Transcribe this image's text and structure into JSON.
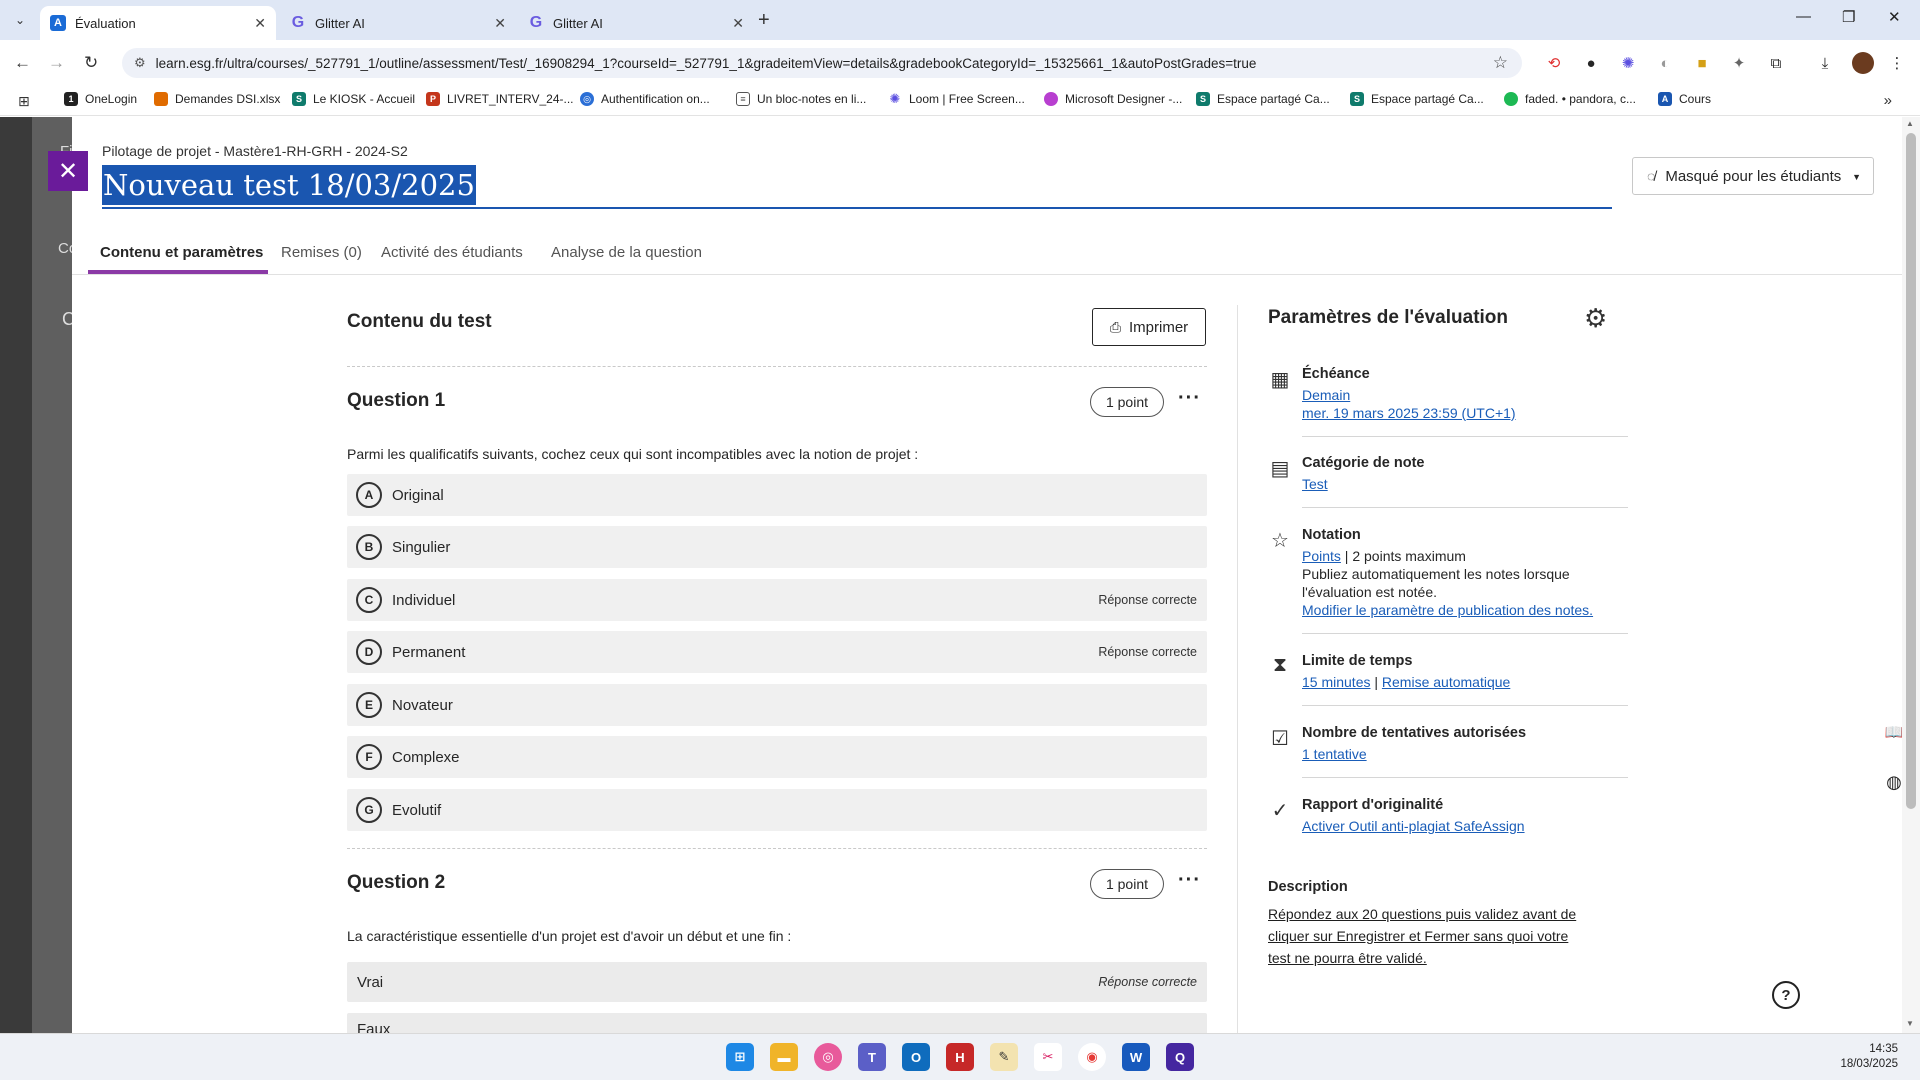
{
  "browser": {
    "tabs": [
      {
        "title": "Évaluation",
        "favicon": "A",
        "active": true
      },
      {
        "title": "Glitter AI",
        "favicon": "G",
        "active": false
      },
      {
        "title": "Glitter AI",
        "favicon": "G",
        "active": false
      }
    ],
    "url": "learn.esg.fr/ultra/courses/_527791_1/outline/assessment/Test/_16908294_1?courseId=_527791_1&gradeitemView=details&gradebookCategoryId=_15325661_1&autoPostGrades=true",
    "bookmarks": [
      "OneLogin",
      "Demandes DSI.xlsx",
      "Le KIOSK - Accueil",
      "LIVRET_INTERV_24-...",
      "Authentification on...",
      "Un bloc-notes en li...",
      "Loom | Free Screen...",
      "Microsoft Designer -...",
      "Espace partagé Ca...",
      "Espace partagé Ca...",
      "faded. • pandora, c...",
      "Cours"
    ]
  },
  "underlay": {
    "stub_top": "Fi",
    "stub_tab": "Co",
    "stub_c": "C"
  },
  "panel": {
    "breadcrumb": "Pilotage de projet - Mastère1-RH-GRH - 2024-S2",
    "title": "Nouveau test 18/03/2025",
    "visibility": "Masqué pour les étudiants",
    "tabs": [
      "Contenu et paramètres",
      "Remises (0)",
      "Activité des étudiants",
      "Analyse de la question"
    ]
  },
  "content": {
    "heading": "Contenu du test",
    "print_label": "Imprimer",
    "questions": [
      {
        "title": "Question 1",
        "points": "1  point",
        "text": "Parmi les qualificatifs suivants, cochez ceux qui sont incompatibles avec la notion de projet :",
        "answers": [
          {
            "letter": "A",
            "text": "Original",
            "correct": ""
          },
          {
            "letter": "B",
            "text": "Singulier",
            "correct": ""
          },
          {
            "letter": "C",
            "text": "Individuel",
            "correct": "Réponse correcte"
          },
          {
            "letter": "D",
            "text": "Permanent",
            "correct": "Réponse correcte"
          },
          {
            "letter": "E",
            "text": "Novateur",
            "correct": ""
          },
          {
            "letter": "F",
            "text": "Complexe",
            "correct": ""
          },
          {
            "letter": "G",
            "text": "Evolutif",
            "correct": ""
          }
        ]
      },
      {
        "title": "Question 2",
        "points": "1  point",
        "text": "La caractéristique essentielle d'un projet est d'avoir un début et une fin :",
        "answers": [
          {
            "text": "Vrai",
            "correct": "Réponse correcte"
          },
          {
            "text": "Faux",
            "correct": ""
          }
        ]
      }
    ]
  },
  "settings": {
    "heading": "Paramètres de l'évaluation",
    "due": {
      "label": "Échéance",
      "line1": "Demain",
      "line2": "mer. 19 mars 2025 23:59 (UTC+1)"
    },
    "category": {
      "label": "Catégorie de note",
      "value": "Test"
    },
    "grading": {
      "label": "Notation",
      "link": "Points",
      "sep": " | ",
      "max": "2 points maximum",
      "text": "Publiez automatiquement les notes lorsque l'évaluation est notée.",
      "modify": "Modifier le paramètre de publication des notes."
    },
    "time": {
      "label": "Limite de temps",
      "value": "15 minutes",
      "sep": " | ",
      "mode": "Remise automatique"
    },
    "attempts": {
      "label": "Nombre de tentatives autorisées",
      "value": "1 tentative"
    },
    "originality": {
      "label": "Rapport d'originalité",
      "value": "Activer Outil anti-plagiat SafeAssign"
    },
    "description": {
      "label": "Description",
      "text": "Répondez aux 20 questions puis validez avant de cliquer sur Enregistrer et Fermer sans quoi votre test ne pourra être validé."
    }
  },
  "taskbar": {
    "time": "14:35",
    "date": "18/03/2025"
  }
}
